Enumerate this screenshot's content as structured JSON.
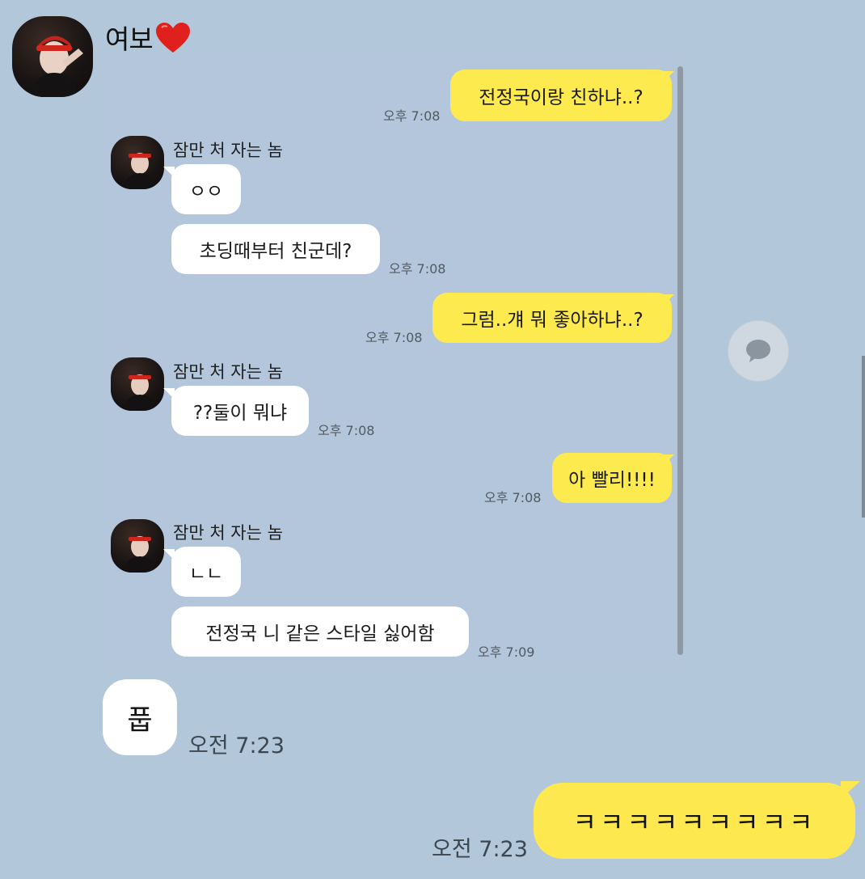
{
  "header": {
    "contact_name": "여보",
    "avatar_icon": "profile-photo-icon",
    "heart_icon": "red-heart-emoji"
  },
  "embedded": {
    "messages": [
      {
        "side": "mine",
        "text": "전정국이랑 친하냐..?",
        "time": "오후 7:08"
      },
      {
        "side": "theirs",
        "sender": "잠만 처 자는 놈",
        "texts": [
          "ㅇㅇ",
          "초딩때부터 친군데?"
        ],
        "time": "오후 7:08"
      },
      {
        "side": "mine",
        "text": "그럼..걔 뭐 좋아하냐..?",
        "time": "오후 7:08"
      },
      {
        "side": "theirs",
        "sender": "잠만 처 자는 놈",
        "texts": [
          "??둘이 뭐냐"
        ],
        "time": "오후 7:08"
      },
      {
        "side": "mine",
        "text": "아 빨리!!!!",
        "time": "오후 7:08"
      },
      {
        "side": "theirs",
        "sender": "잠만 처 자는 놈",
        "texts": [
          "ㄴㄴ",
          "전정국 니 같은 스타일 싫어함"
        ],
        "time": "오후 7:09"
      }
    ]
  },
  "outer_chat": {
    "incoming": {
      "text": "풉",
      "time": "오전 7:23"
    },
    "outgoing": {
      "text": "ㅋㅋㅋㅋㅋㅋㅋㅋㅋ",
      "time": "오전 7:23"
    }
  },
  "side_button": {
    "icon": "chat-bubble-icon"
  },
  "colors": {
    "background": "#b2c7da",
    "my_bubble": "#fdea4f",
    "their_bubble": "#ffffff"
  }
}
